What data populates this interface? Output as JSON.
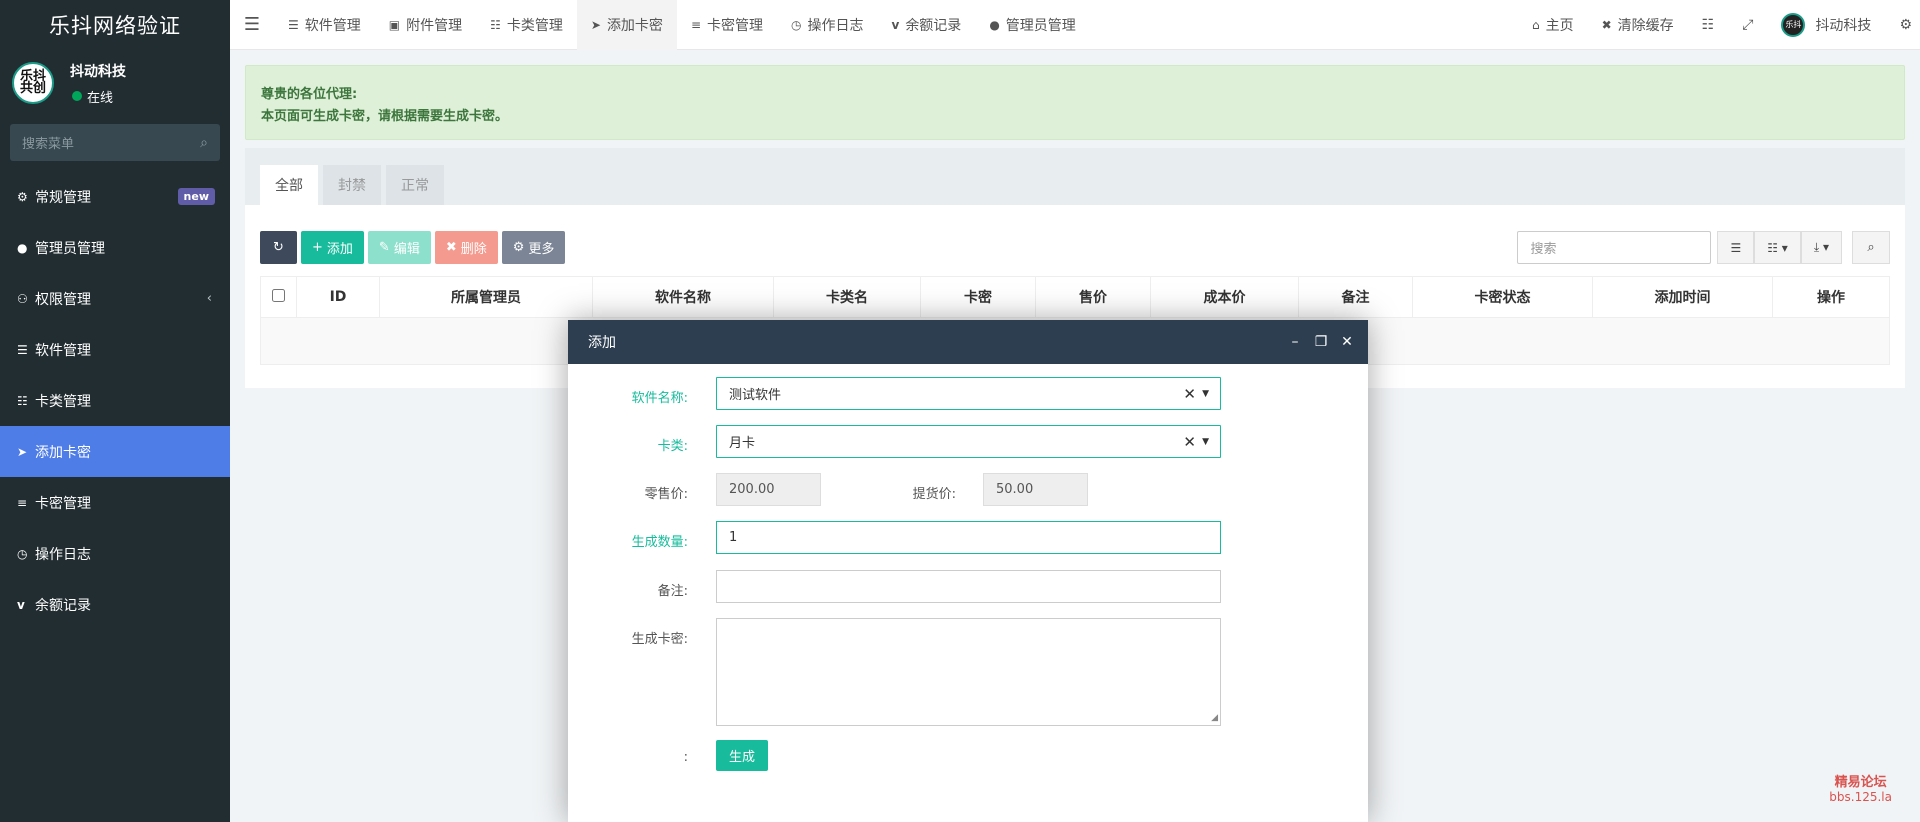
{
  "sidebar": {
    "brand": "乐抖网络验证",
    "avatar_text": "乐抖 共创",
    "user_name": "抖动科技",
    "status": "在线",
    "search_placeholder": "搜索菜单",
    "menu": [
      {
        "label": "常规管理",
        "icon": "cogs-icon",
        "badge": "new"
      },
      {
        "label": "管理员管理",
        "icon": "user-icon"
      },
      {
        "label": "权限管理",
        "icon": "group-icon"
      },
      {
        "label": "软件管理",
        "icon": "list-icon"
      },
      {
        "label": "卡类管理",
        "icon": "tasks-icon"
      },
      {
        "label": "添加卡密",
        "icon": "paper-plane-icon",
        "active": true
      },
      {
        "label": "卡密管理",
        "icon": "rss-icon"
      },
      {
        "label": "操作日志",
        "icon": "clock-icon"
      },
      {
        "label": "余额记录",
        "icon": "vimeo-icon"
      }
    ]
  },
  "topnav": {
    "tabs": [
      {
        "label": "软件管理",
        "icon": "list-icon"
      },
      {
        "label": "附件管理",
        "icon": "image-icon"
      },
      {
        "label": "卡类管理",
        "icon": "tasks-icon"
      },
      {
        "label": "添加卡密",
        "icon": "paper-plane-icon",
        "active": true
      },
      {
        "label": "卡密管理",
        "icon": "rss-icon"
      },
      {
        "label": "操作日志",
        "icon": "clock-icon"
      },
      {
        "label": "余额记录",
        "icon": "vimeo-icon"
      },
      {
        "label": "管理员管理",
        "icon": "user-icon"
      }
    ],
    "home": "主页",
    "clear_cache": "清除缓存",
    "user": "抖动科技"
  },
  "alert": {
    "line1": "尊贵的各位代理:",
    "line2": "本页面可生成卡密，请根据需要生成卡密。"
  },
  "panel_tabs": [
    "全部",
    "封禁",
    "正常"
  ],
  "toolbar": {
    "add": "添加",
    "edit": "编辑",
    "delete": "删除",
    "more": "更多",
    "search_placeholder": "搜索"
  },
  "table_headers": [
    "ID",
    "所属管理员",
    "软件名称",
    "卡类名",
    "卡密",
    "售价",
    "成本价",
    "备注",
    "卡密状态",
    "添加时间",
    "操作"
  ],
  "modal": {
    "title": "添加",
    "software_label": "软件名称:",
    "software_value": "测试软件",
    "cardtype_label": "卡类:",
    "cardtype_value": "月卡",
    "retail_label": "零售价:",
    "retail_value": "200.00",
    "cost_label": "提货价:",
    "cost_value": "50.00",
    "quantity_label": "生成数量:",
    "quantity_value": "1",
    "remark_label": "备注:",
    "remark_value": "",
    "cards_label": "生成卡密:",
    "cards_value": "",
    "empty_label": ":",
    "generate_button": "生成"
  },
  "watermark": {
    "line1": "精易论坛",
    "line2": "bbs.125.la"
  }
}
